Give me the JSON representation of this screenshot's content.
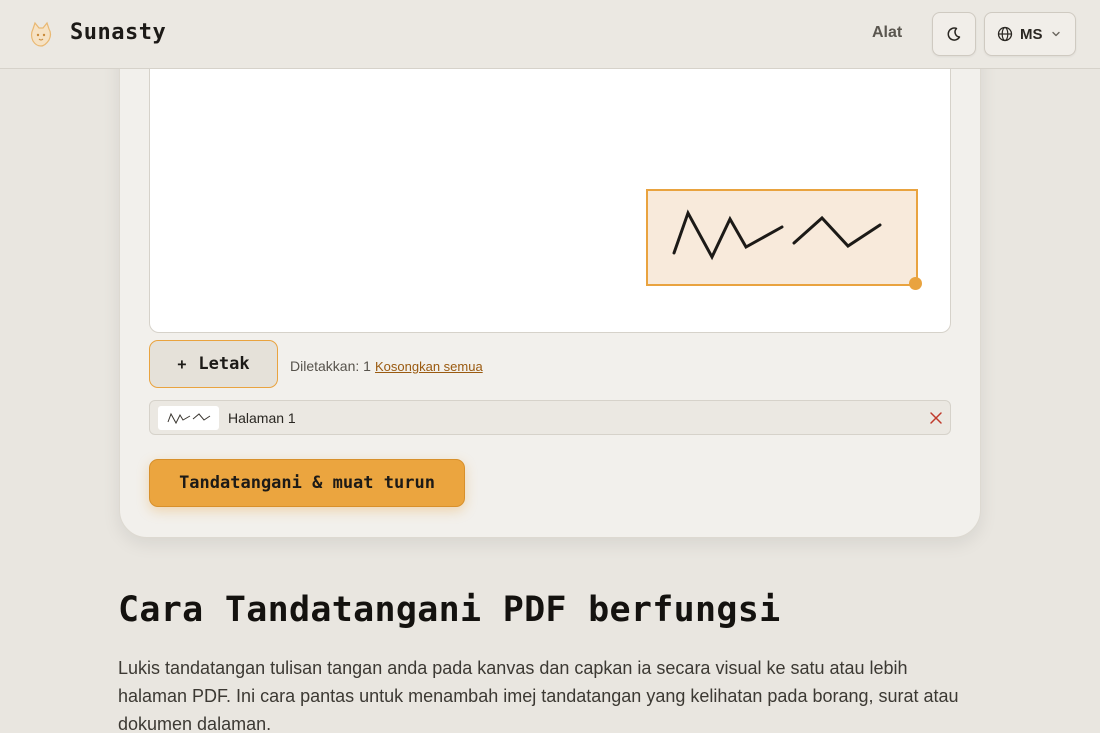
{
  "header": {
    "brand": "Sunasty",
    "nav_tools": "Alat",
    "lang_code": "MS"
  },
  "editor": {
    "place_button_label": "Letak",
    "place_button_plus": "+",
    "placed_count": "Diletakkan: 1",
    "clear_all": "Kosongkan semua",
    "page_label": "Halaman 1",
    "sign_download": "Tandatangani & muat turun"
  },
  "content": {
    "heading": "Cara Tandatangani PDF berfungsi",
    "description": "Lukis tandatangan tulisan tangan anda pada kanvas dan capkan ia secara visual ke satu atau lebih halaman PDF. Ini cara pantas untuk menambah imej tandatangan yang kelihatan pada borang, surat atau dokumen dalaman."
  },
  "colors": {
    "accent": "#eba53f",
    "link": "#9a5a10",
    "remove": "#c0392b"
  },
  "icons": [
    "cat-logo-icon",
    "moon-icon",
    "globe-icon",
    "chevron-down-icon",
    "close-icon"
  ]
}
